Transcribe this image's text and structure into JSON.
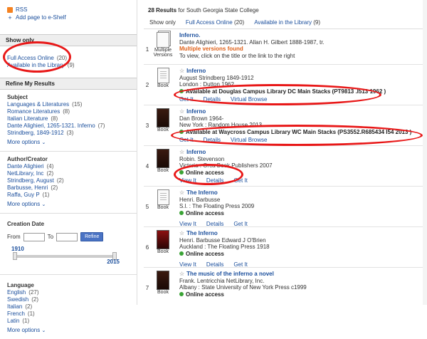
{
  "sidebar": {
    "rss_label": "RSS",
    "add_shelf_label": "Add page to e-Shelf",
    "show_only": {
      "header": "Show only",
      "items": [
        {
          "label": "Full Access Online",
          "count": "(20)"
        },
        {
          "label": "Available in the Library",
          "count": "(9)"
        }
      ]
    },
    "refine": {
      "header": "Refine My Results",
      "subject_title": "Subject",
      "subjects": [
        {
          "label": "Languages & Literatures",
          "count": "(15)"
        },
        {
          "label": "Romance Literatures",
          "count": "(8)"
        },
        {
          "label": "Italian Literature",
          "count": "(8)"
        },
        {
          "label": "Dante Alighieri, 1265-1321. Inferno",
          "count": "(7)"
        },
        {
          "label": "Strindberg, 1849-1912",
          "count": "(3)"
        }
      ],
      "more_options": "More options",
      "author_title": "Author/Creator",
      "authors": [
        {
          "label": "Dante Alighieri",
          "count": "(4)"
        },
        {
          "label": "NetLibrary, Inc",
          "count": "(2)"
        },
        {
          "label": "Strindberg, August",
          "count": "(2)"
        },
        {
          "label": "Barbusse, Henri",
          "count": "(2)"
        },
        {
          "label": "Raffa, Guy P",
          "count": "(1)"
        }
      ],
      "creation_date_title": "Creation Date",
      "from_label": "From",
      "to_label": "To",
      "refine_button": "Refine",
      "slider_min": "1910",
      "slider_max": "2015",
      "language_title": "Language",
      "languages": [
        {
          "label": "English",
          "count": "(27)"
        },
        {
          "label": "Swedish",
          "count": "(2)"
        },
        {
          "label": "Italian",
          "count": "(2)"
        },
        {
          "label": "French",
          "count": "(1)"
        },
        {
          "label": "Latin",
          "count": "(1)"
        }
      ]
    }
  },
  "main": {
    "results_count": "28 Results",
    "results_for": "for South Georgia State College",
    "show_only_label": "Show only",
    "filter_online": "Full Access Online",
    "filter_online_count": "(20)",
    "filter_library": "Available in the Library",
    "filter_library_count": "(9)",
    "records": [
      {
        "num": "1",
        "thumb_label": "Multiple Versions",
        "title": "Inferno.",
        "line1": "Dante Alighieri, 1265-1321. Allan H. Gilbert 1888-1987, tr.",
        "line2": "Multiple versions found",
        "line3": "To view, click on the title or the link to the right"
      },
      {
        "num": "2",
        "thumb_label": "Book",
        "title": "Inferno",
        "line1": "August Strindberg 1849-1912",
        "line2": "London : Dutton 1962",
        "avail": "Available at Douglas Campus Library DC Main Stacks (PT9813 .I513 1962 )",
        "actions": [
          "Get It",
          "Details",
          "Virtual Browse"
        ]
      },
      {
        "num": "3",
        "thumb_label": "Book",
        "title": "Inferno",
        "line1": "Dan Brown 1964-",
        "line2": "New York : Random House 2013",
        "avail": "Available at Waycross Campus Library WC Main Stacks (PS3552.R685434 I54 2013 )",
        "actions": [
          "Get It",
          "Details",
          "Virtual Browse"
        ]
      },
      {
        "num": "4",
        "thumb_label": "Book",
        "title": "Inferno",
        "line1": "Robin. Stevenson",
        "line2": "Victoria : Orca Book Publishers 2007",
        "avail": "Online access",
        "actions": [
          "View It",
          "Details",
          "Get It"
        ]
      },
      {
        "num": "5",
        "thumb_label": "Book",
        "title": "The Inferno",
        "line1": "Henri. Barbusse",
        "line2": "S.l. : The Floating Press 2009",
        "avail": "Online access",
        "actions": [
          "View It",
          "Details",
          "Get It"
        ]
      },
      {
        "num": "6",
        "thumb_label": "Book",
        "title": "The Inferno",
        "line1": "Henri. Barbusse Edward J O'Brien",
        "line2": "Auckland : The Floating Press 1918",
        "avail": "Online access",
        "actions": [
          "View It",
          "Details",
          "Get It"
        ]
      },
      {
        "num": "7",
        "thumb_label": "Book",
        "title": "The music of the inferno a novel",
        "line1": "Frank. Lentricchia NetLibrary, Inc.",
        "line2": "Albany : State University of New York Press c1999",
        "avail": "Online access",
        "actions": []
      }
    ]
  },
  "colors": {
    "annotation": "#e81818",
    "link": "#1a4e9c",
    "available_dot": "#3aa335",
    "warning": "#e0621a"
  }
}
